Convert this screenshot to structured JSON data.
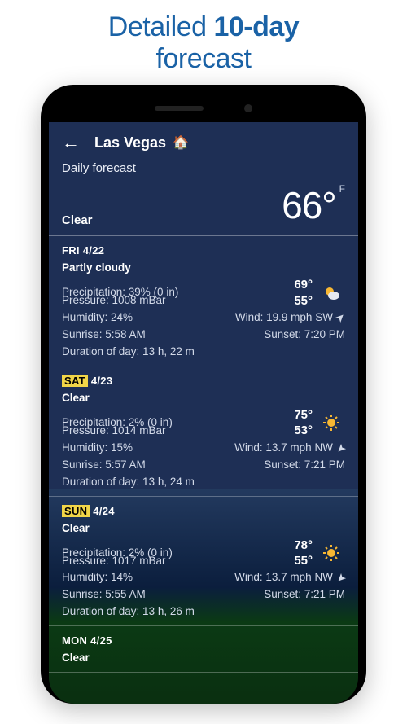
{
  "promo": {
    "line1_a": "Detailed ",
    "line1_b": "10-day",
    "line2": "forecast"
  },
  "app": {
    "location": "Las Vegas",
    "section": "Daily forecast",
    "current": {
      "condition": "Clear",
      "temp": "66°",
      "unit": "F"
    }
  },
  "labels": {
    "precipitation": "Precipitation:",
    "pressure": "Pressure:",
    "humidity": "Humidity:",
    "wind": "Wind:",
    "sunrise": "Sunrise:",
    "sunset": "Sunset:",
    "duration": "Duration of day:"
  },
  "days": [
    {
      "head": "FRI 4/22",
      "highlight": false,
      "condition": "Partly cloudy",
      "icon": "partly-cloudy",
      "hi": "69°",
      "lo": "55°",
      "precip": "39% (0 in)",
      "pressure": "1008 mBar",
      "humidity": "24%",
      "wind": "19.9 mph SW",
      "windDir": "ne",
      "sunrise": "5:58 AM",
      "sunset": "7:20 PM",
      "duration": "13 h, 22 m"
    },
    {
      "head": "SAT 4/23",
      "highlight": true,
      "condition": "Clear",
      "icon": "sun",
      "hi": "75°",
      "lo": "53°",
      "precip": "2% (0 in)",
      "pressure": "1014 mBar",
      "humidity": "15%",
      "wind": "13.7 mph NW",
      "windDir": "se",
      "sunrise": "5:57 AM",
      "sunset": "7:21 PM",
      "duration": "13 h, 24 m"
    },
    {
      "head": "SUN 4/24",
      "highlight": true,
      "condition": "Clear",
      "icon": "sun",
      "hi": "78°",
      "lo": "55°",
      "precip": "2% (0 in)",
      "pressure": "1017 mBar",
      "humidity": "14%",
      "wind": "13.7 mph NW",
      "windDir": "se",
      "sunrise": "5:55 AM",
      "sunset": "7:21 PM",
      "duration": "13 h, 26 m"
    },
    {
      "head": "MON 4/25",
      "highlight": false,
      "condition": "Clear",
      "icon": "sun",
      "hi": "",
      "lo": "",
      "precip": "",
      "pressure": "",
      "humidity": "",
      "wind": "",
      "windDir": "",
      "sunrise": "",
      "sunset": "",
      "duration": ""
    }
  ]
}
